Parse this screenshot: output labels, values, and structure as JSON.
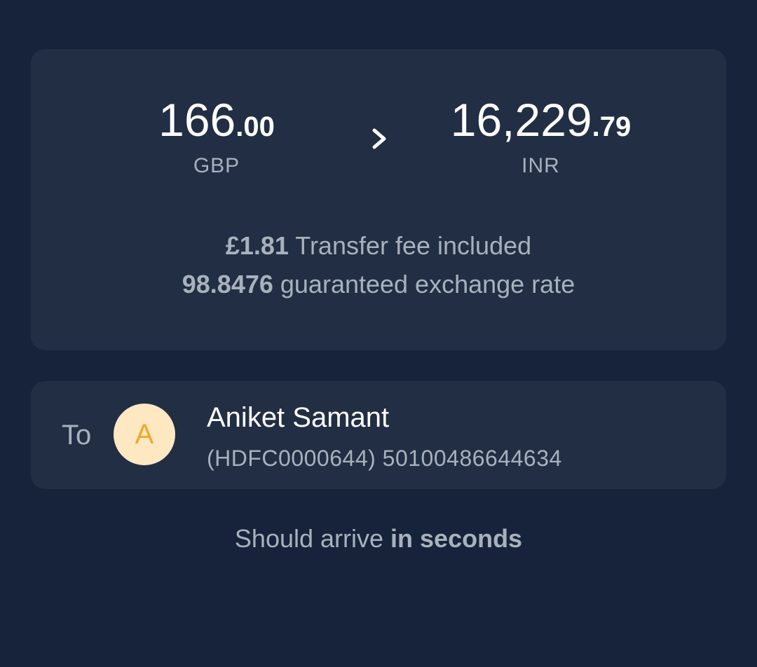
{
  "transfer": {
    "send_amount_major": "166",
    "send_amount_minor": ".00",
    "send_currency": "GBP",
    "receive_amount_major": "16,229",
    "receive_amount_minor": ".79",
    "receive_currency": "INR",
    "arrow_icon": "chevron-right-icon"
  },
  "fees": {
    "fee_amount": "£1.81",
    "fee_text": " Transfer fee included",
    "rate_value": "98.8476",
    "rate_text": " guaranteed exchange rate"
  },
  "recipient": {
    "to_label": "To",
    "avatar_initial": "A",
    "name": "Aniket Samant",
    "account": "(HDFC0000644) 50100486644634"
  },
  "delivery": {
    "eta_prefix": "Should arrive ",
    "eta_emphasis": "in seconds"
  },
  "colors": {
    "background": "#16233a",
    "card": "#212e44",
    "avatar_bg": "#fde8c2",
    "avatar_fg": "#f0a92a"
  }
}
